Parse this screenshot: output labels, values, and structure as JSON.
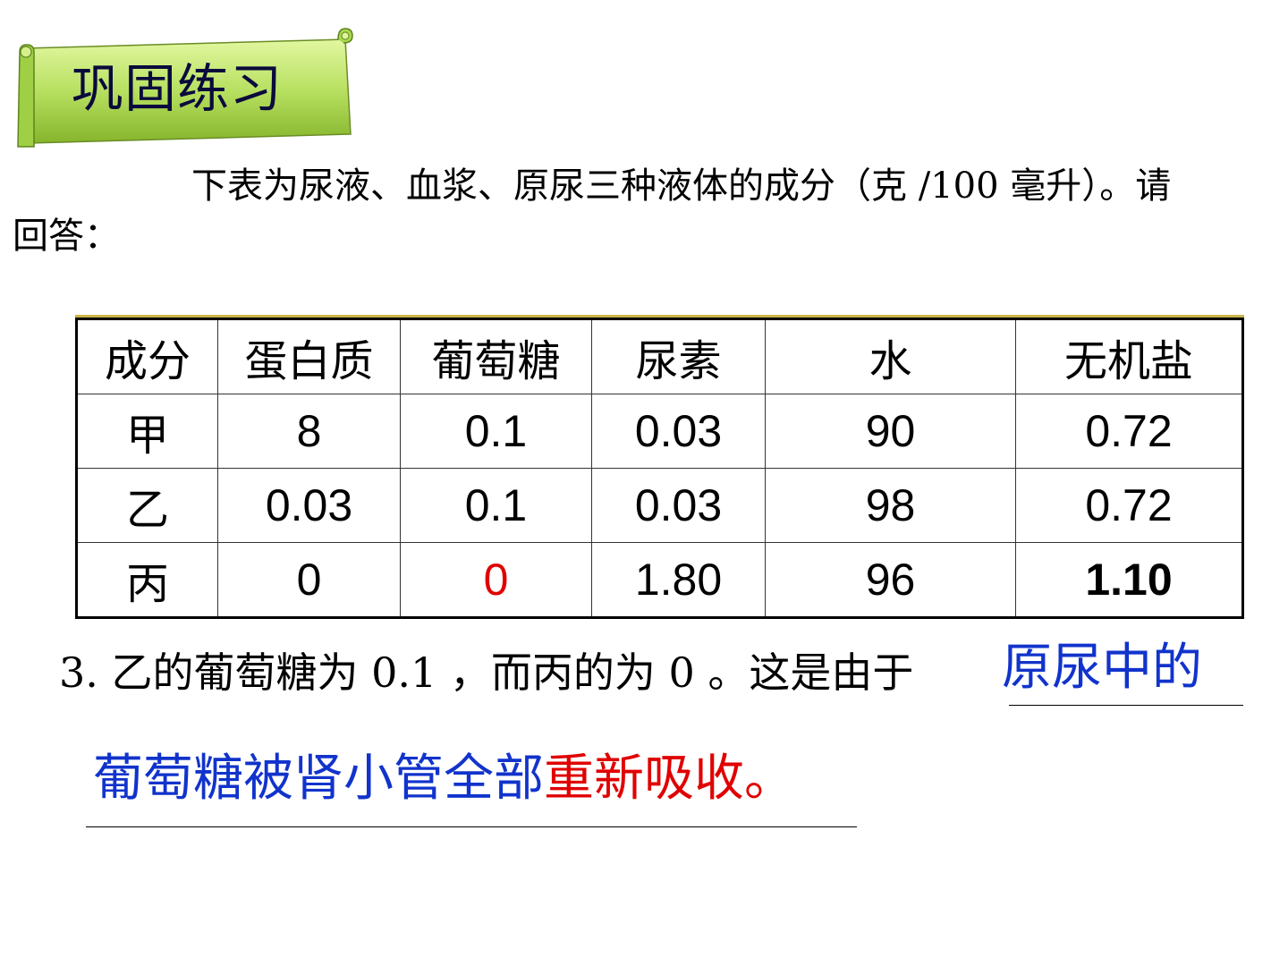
{
  "banner": {
    "title": "巩固练习"
  },
  "intro": {
    "text": "下表为尿液、血浆、原尿三种液体的成分（克 /100 毫升）。请回答："
  },
  "table": {
    "header": [
      "成分",
      "蛋白质",
      "葡萄糖",
      "尿素",
      "水",
      "无机盐"
    ],
    "rows": [
      [
        "甲",
        "8",
        "0.1",
        "0.03",
        "90",
        "0.72"
      ],
      [
        "乙",
        "0.03",
        "0.1",
        "0.03",
        "98",
        "0.72"
      ],
      [
        "丙",
        "0",
        "0",
        "1.80",
        "96",
        "1.10"
      ]
    ]
  },
  "question": {
    "text": "3. 乙的葡萄糖为 0.1 ，而丙的为 0 。这是由于"
  },
  "answer": {
    "line1": "原尿中的",
    "line2_part1": "葡萄糖被肾小管全部",
    "line2_part2": "重新吸收。"
  },
  "colors": {
    "banner_green_light": "#d8f08a",
    "banner_green_dark": "#7fb02a",
    "answer_blue": "#1133cc",
    "highlight_red": "#e00000"
  }
}
